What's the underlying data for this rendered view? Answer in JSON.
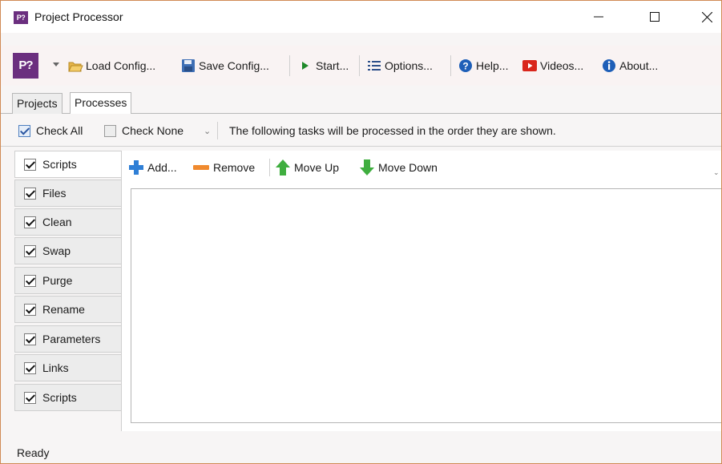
{
  "window": {
    "logo_text": "P?",
    "title": "Project Processor"
  },
  "toolbar": {
    "logo_text": "P?",
    "load_config": "Load Config...",
    "save_config": "Save Config...",
    "start": "Start...",
    "options": "Options...",
    "help": "Help...",
    "videos": "Videos...",
    "about": "About..."
  },
  "tabs": [
    {
      "label": "Projects",
      "active": false
    },
    {
      "label": "Processes",
      "active": true
    }
  ],
  "check_row": {
    "check_all": "Check All",
    "check_all_checked": true,
    "check_none": "Check None",
    "check_none_checked": false,
    "grip": "⌄",
    "info": "The following tasks will be processed in the order they are shown."
  },
  "sidebar": {
    "items": [
      {
        "label": "Scripts",
        "checked": true,
        "active": true
      },
      {
        "label": "Files",
        "checked": true,
        "active": false
      },
      {
        "label": "Clean",
        "checked": true,
        "active": false
      },
      {
        "label": "Swap",
        "checked": true,
        "active": false
      },
      {
        "label": "Purge",
        "checked": true,
        "active": false
      },
      {
        "label": "Rename",
        "checked": true,
        "active": false
      },
      {
        "label": "Parameters",
        "checked": true,
        "active": false
      },
      {
        "label": "Links",
        "checked": true,
        "active": false
      },
      {
        "label": "Scripts",
        "checked": true,
        "active": false
      }
    ]
  },
  "panel": {
    "add": "Add...",
    "remove": "Remove",
    "move_up": "Move Up",
    "move_down": "Move Down",
    "grip": "⌄"
  },
  "status": {
    "text": "Ready"
  },
  "colors": {
    "brand_purple": "#6b2f7f",
    "window_border": "#d08a55",
    "toolbar_bg": "#f9f3f3",
    "add_blue": "#2f7fd6",
    "remove_orange": "#f08a2e",
    "arrow_green": "#3fae3f",
    "video_red": "#d9261c",
    "help_blue": "#1e5fb8"
  },
  "icons": {
    "load_config": "folder-open-icon",
    "save_config": "floppy-disk-icon",
    "start": "play-icon",
    "options": "list-icon",
    "help": "help-icon",
    "videos": "video-icon",
    "about": "info-icon",
    "add": "plus-icon",
    "remove": "minus-icon",
    "move_up": "arrow-up-icon",
    "move_down": "arrow-down-icon"
  }
}
